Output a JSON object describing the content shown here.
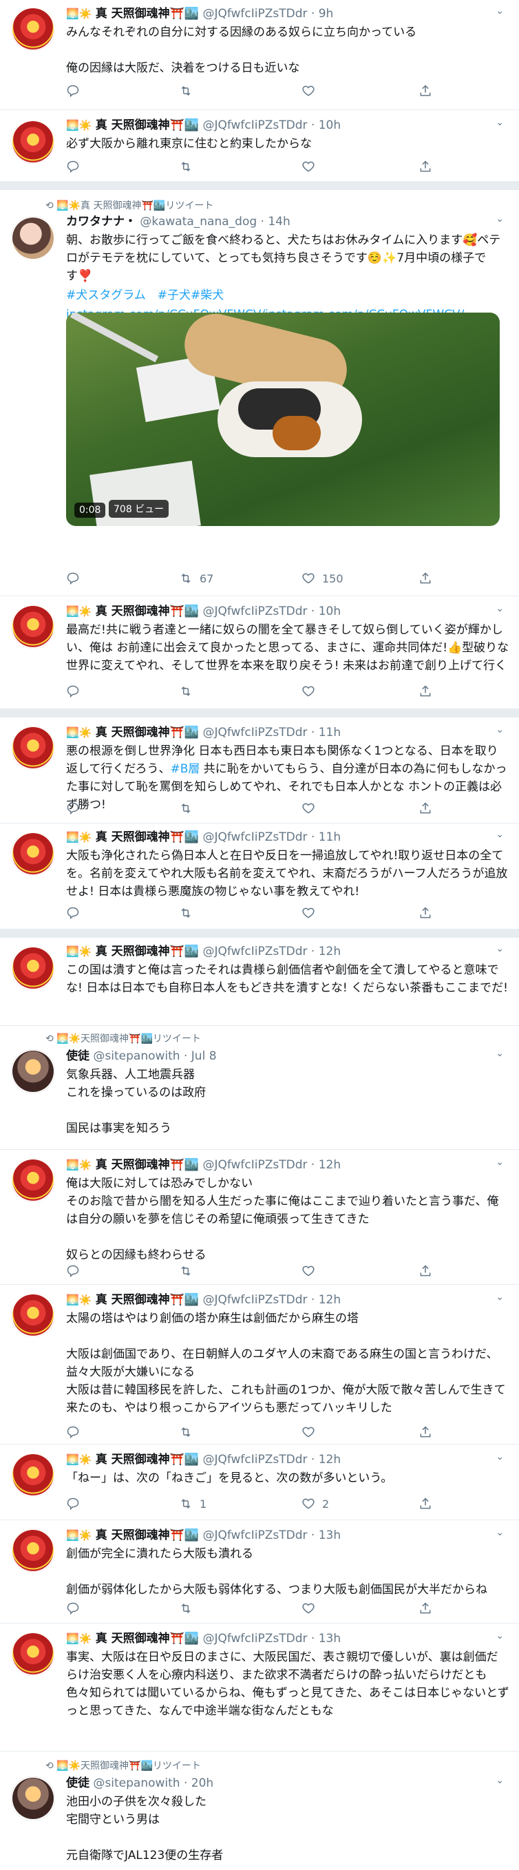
{
  "icons": {
    "reply": "reply-icon",
    "retweet": "retweet-icon",
    "like": "like-icon",
    "share": "share-icon",
    "more": "chevron-down-icon",
    "retweeted": "retweet-small-icon"
  },
  "colors": {
    "link": "#1da1f2",
    "muted": "#657786",
    "border": "#e6ecf0"
  },
  "tweets": [
    {
      "emoji": "🌅☀️",
      "name": "真 天照御魂神⛩️🏙️",
      "handle": "@JQfwfcIiPZsTDdr",
      "time": "9h",
      "text": "みんなそれぞれの自分に対する因縁のある奴らに立ち向かっている\n\n俺の因縁は大阪だ、決着をつける日も近いな",
      "reply": "",
      "retweet": "",
      "like": ""
    },
    {
      "emoji": "🌅☀️",
      "name": "真 天照御魂神⛩️🏙️",
      "handle": "@JQfwfcIiPZsTDdr",
      "time": "10h",
      "text": "必ず大阪から離れ東京に住むと約束したからな",
      "reply": "",
      "retweet": "",
      "like": ""
    },
    {
      "rt_label": "🌅☀️真 天照御魂神⛩️🏙️リツイート",
      "name": "カワタナナ・",
      "handle": "@kawata_nana_dog",
      "time": "14h",
      "text": "朝、お散歩に行ってご飯を食べ終わると、犬たちはお休みタイムに入ります🥰ペテロがテモテを枕にしていて、とっても気持ち良さそうです☺️✨7月中頃の様子です❣️",
      "tags": "#犬スタグラム　#子犬#柴犬",
      "url": "instagram.com/p/CCuFOwVFWCV/instagram.com/p/CCuFOwVFWCV/",
      "video_time": "0:08",
      "video_views": "708 ビュー",
      "reply": "",
      "retweet": "67",
      "like": "150"
    },
    {
      "emoji": "🌅☀️",
      "name": "真 天照御魂神⛩️🏙️",
      "handle": "@JQfwfcIiPZsTDdr",
      "time": "10h",
      "text": "最高だ!共に戦う者達と一緒に奴らの闇を全て暴きそして奴ら倒していく姿が輝かしい、俺は お前達に出会えて良かったと思ってる、まさに、運命共同体だ!👍型破りな世界に変えてやれ、そして世界を本来を取り戻そう! 未来はお前達で創り上げて行く",
      "reply": "",
      "retweet": "",
      "like": ""
    },
    {
      "emoji": "🌅☀️",
      "name": "真 天照御魂神⛩️🏙️",
      "handle": "@JQfwfcIiPZsTDdr",
      "time": "11h",
      "text_a": "悪の根源を倒し世界浄化 日本も西日本も東日本も関係なく1つとなる、日本を取り返して行くだろう、",
      "hashtag": "#B層",
      "text_b": " 共に恥をかいてもらう、自分達が日本の為に何もしなかった事に対して恥を罵倒を知らしめてやれ、それでも日本人かとな ホントの正義は必ず勝つ!",
      "reply": "",
      "retweet": "",
      "like": ""
    },
    {
      "emoji": "🌅☀️",
      "name": "真 天照御魂神⛩️🏙️",
      "handle": "@JQfwfcIiPZsTDdr",
      "time": "11h",
      "text": "大阪も浄化されたら偽日本人と在日や反日を一掃追放してやれ!取り返せ日本の全てを。名前を変えてやれ大阪も名前を変えてやれ、末裔だろうがハーフ人だろうが追放せよ! 日本は貴様ら悪魔族の物じゃない事を教えてやれ!",
      "reply": "",
      "retweet": "",
      "like": ""
    },
    {
      "emoji": "🌅☀️",
      "name": "真 天照御魂神⛩️🏙️",
      "handle": "@JQfwfcIiPZsTDdr",
      "time": "12h",
      "text": "この国は潰すと俺は言ったそれは貴様ら創価信者や創価を全て潰してやると意味でな! 日本は日本でも自称日本人をもどき共を潰すとな! くだらない茶番もここまでだ!",
      "reply": "",
      "retweet": "",
      "like": ""
    },
    {
      "rt_label": "🌅☀️天照御魂神⛩️🏙️リツイート",
      "name": "使徒",
      "handle": "@sitepanowith",
      "time": "Jul 8",
      "text": "気象兵器、人工地震兵器\nこれを操っているのは政府\n\n国民は事実を知ろう",
      "reply": "",
      "retweet": "",
      "like": ""
    },
    {
      "emoji": "🌅☀️",
      "name": "真 天照御魂神⛩️🏙️",
      "handle": "@JQfwfcIiPZsTDdr",
      "time": "12h",
      "text": "俺は大阪に対しては恐みでしかない\nそのお陰で昔から闇を知る人生だった事に俺はここまで辿り着いたと言う事だ、俺は自分の願いを夢を信じその希望に俺頑張って生きてきた\n\n奴らとの因縁も終わらせる",
      "reply": "",
      "retweet": "",
      "like": ""
    },
    {
      "emoji": "🌅☀️",
      "name": "真 天照御魂神⛩️🏙️",
      "handle": "@JQfwfcIiPZsTDdr",
      "time": "12h",
      "text": "太陽の塔はやはり創価の塔か麻生は創価だから麻生の塔\n\n大阪は創価国であり、在日朝鮮人のユダヤ人の末裔である麻生の国と言うわけだ、益々大阪が大嫌いになる\n大阪は昔に韓国移民を許した、これも計画の1つか、俺が大阪で散々苦しんで生きて来たのも、やはり根っこからアイツらも悪だってハッキリした",
      "reply": "",
      "retweet": "",
      "like": ""
    },
    {
      "emoji": "🌅☀️",
      "name": "真 天照御魂神⛩️🏙️",
      "handle": "@JQfwfcIiPZsTDdr",
      "time": "12h",
      "text": "「ねー」は、次の「ねきご」を見ると、次の数が多いという。",
      "reply": "",
      "retweet": "1",
      "like": "2"
    },
    {
      "emoji": "🌅☀️",
      "name": "真 天照御魂神⛩️🏙️",
      "handle": "@JQfwfcIiPZsTDdr",
      "time": "13h",
      "text": "創価が完全に潰れたら大阪も潰れる\n\n創価が弱体化したから大阪も弱体化する、つまり大阪も創価国民が大半だからね",
      "reply": "",
      "retweet": "",
      "like": ""
    },
    {
      "emoji": "🌅☀️",
      "name": "真 天照御魂神⛩️🏙️",
      "handle": "@JQfwfcIiPZsTDdr",
      "time": "13h",
      "text": "事実、大阪は在日や反日のまさに、大阪民国だ、表さ親切で優しいが、裏は創価だらけ治安悪く人を心療内科送り、また欲求不満者だらけの酔っ払いだらけだとも色々知られては聞いているからね、俺もずっと見てきた、あそこは日本じゃないとずっと思ってきた、なんで中途半端な街なんだともな",
      "reply": "",
      "retweet": "",
      "like": ""
    },
    {
      "rt_label": "🌅☀️天照御魂神⛩️🏙️リツイート",
      "name": "使徒",
      "handle": "@sitepanowith",
      "time": "20h",
      "text": "池田小の子供を次々殺した\n宅間守という男は\n\n元自衛隊でJAL123便の生存者",
      "reply": "",
      "retweet": "",
      "like": ""
    }
  ]
}
